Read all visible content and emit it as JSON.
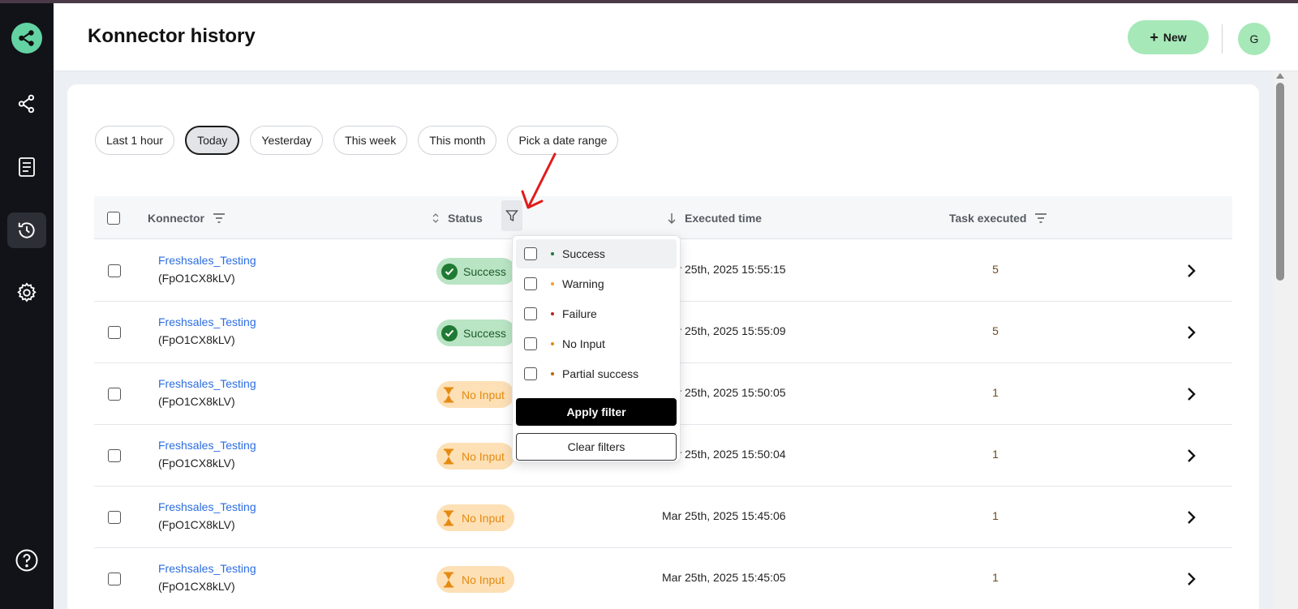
{
  "header": {
    "title": "Konnector history",
    "new_label": "New",
    "avatar_initial": "G"
  },
  "filters": {
    "chips": [
      {
        "label": "Last 1 hour",
        "active": false
      },
      {
        "label": "Today",
        "active": true
      },
      {
        "label": "Yesterday",
        "active": false
      },
      {
        "label": "This week",
        "active": false
      },
      {
        "label": "This month",
        "active": false
      },
      {
        "label": "Pick a date range",
        "active": false
      }
    ]
  },
  "table": {
    "columns": {
      "konnector": "Konnector",
      "status": "Status",
      "executed_time": "Executed time",
      "task_executed": "Task executed"
    },
    "rows": [
      {
        "name": "Freshsales_Testing",
        "id": "(FpO1CX8kLV)",
        "status": "Success",
        "status_type": "success",
        "time": "Mar 25th, 2025 15:55:15",
        "tasks": "5"
      },
      {
        "name": "Freshsales_Testing",
        "id": "(FpO1CX8kLV)",
        "status": "Success",
        "status_type": "success",
        "time": "Mar 25th, 2025 15:55:09",
        "tasks": "5"
      },
      {
        "name": "Freshsales_Testing",
        "id": "(FpO1CX8kLV)",
        "status": "No Input",
        "status_type": "noinput",
        "time": "Mar 25th, 2025 15:50:05",
        "tasks": "1"
      },
      {
        "name": "Freshsales_Testing",
        "id": "(FpO1CX8kLV)",
        "status": "No Input",
        "status_type": "noinput",
        "time": "Mar 25th, 2025 15:50:04",
        "tasks": "1"
      },
      {
        "name": "Freshsales_Testing",
        "id": "(FpO1CX8kLV)",
        "status": "No Input",
        "status_type": "noinput",
        "time": "Mar 25th, 2025 15:45:06",
        "tasks": "1"
      },
      {
        "name": "Freshsales_Testing",
        "id": "(FpO1CX8kLV)",
        "status": "No Input",
        "status_type": "noinput",
        "time": "Mar 25th, 2025 15:45:05",
        "tasks": "1"
      }
    ]
  },
  "status_filter": {
    "options": [
      {
        "label": "Success",
        "dot_color": "#1f7a33"
      },
      {
        "label": "Warning",
        "dot_color": "#f0a030"
      },
      {
        "label": "Failure",
        "dot_color": "#c0231d"
      },
      {
        "label": "No Input",
        "dot_color": "#e48a12"
      },
      {
        "label": "Partial success",
        "dot_color": "#b8660e"
      }
    ],
    "apply_label": "Apply filter",
    "clear_label": "Clear filters"
  },
  "colors": {
    "accent_green": "#a6e8b8",
    "link_blue": "#2b6de0",
    "annotation_red": "#e01b1b"
  }
}
